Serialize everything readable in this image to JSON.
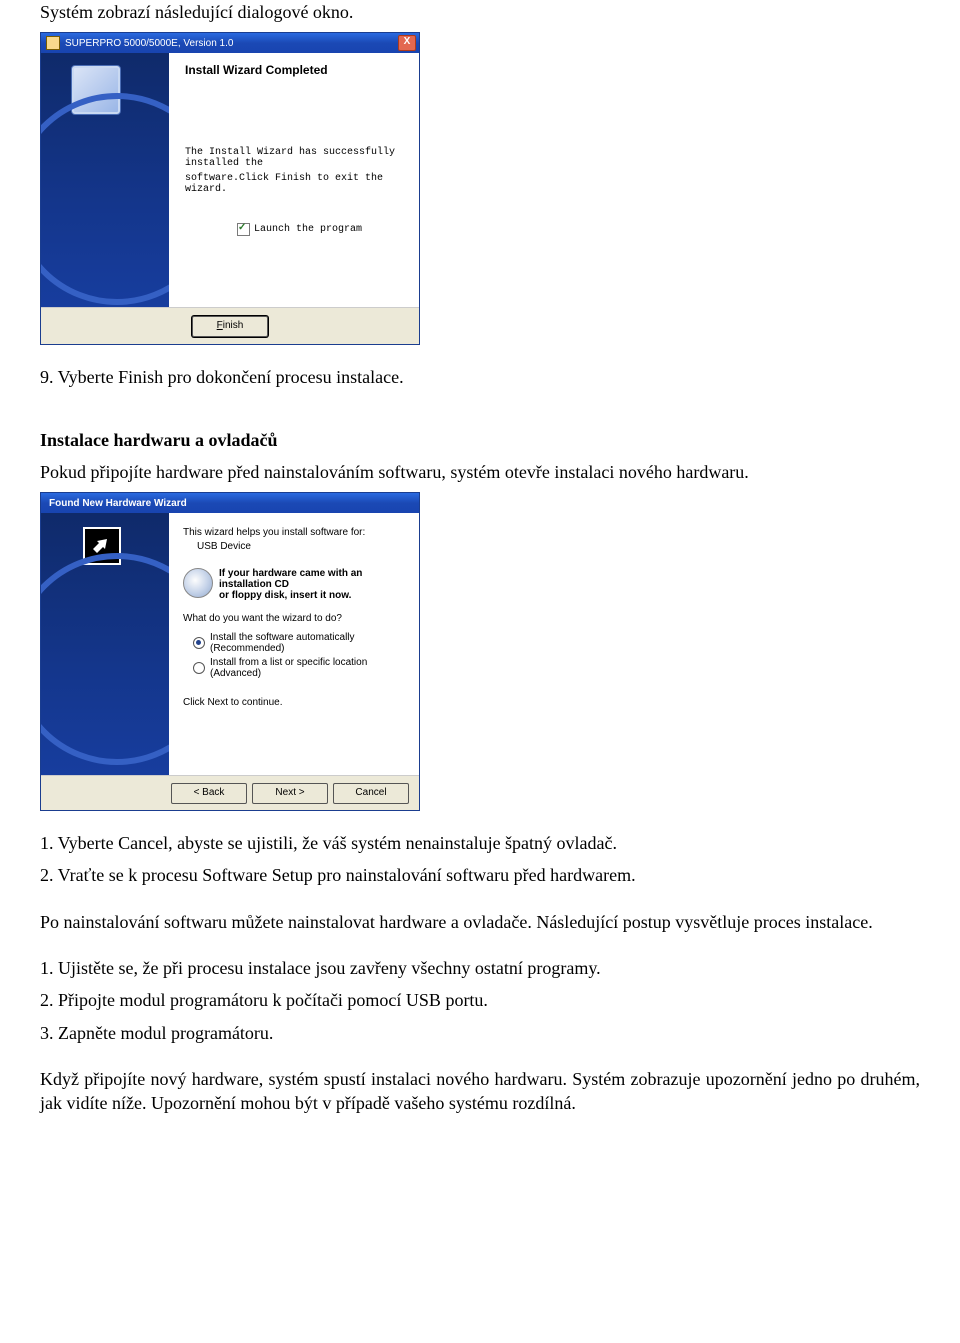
{
  "doc": {
    "intro": "Systém zobrazí následující dialogové okno.",
    "after_dlg1": "9. Vyberte Finish pro dokončení procesu instalace.",
    "section_title": "Instalace hardwaru a ovladačů",
    "section_intro": "Pokud připojíte hardware před nainstalováním softwaru, systém otevře instalaci nového hardwaru.",
    "numbered1": "1. Vyberte Cancel, abyste se ujistili, že váš systém nenainstaluje špatný ovladač.",
    "numbered2": "2. Vraťte se k procesu Software Setup pro nainstalování softwaru před hardwarem.",
    "para2": "Po nainstalování softwaru můžete nainstalovat hardware a ovladače. Následující postup vysvětluje proces instalace.",
    "num2_1": "1. Ujistěte se, že při procesu instalace jsou zavřeny všechny ostatní programy.",
    "num2_2": "2. Připojte modul programátoru k počítači pomocí USB portu.",
    "num2_3": "3. Zapněte modul programátoru.",
    "final": "Když připojíte nový hardware, systém spustí instalaci nového hardwaru. Systém zobrazuje upozornění jedno po druhém, jak vidíte níže. Upozornění mohou být v případě vašeho systému rozdílná."
  },
  "dlg1": {
    "title": "SUPERPRO 5000/5000E, Version 1.0",
    "close": "X",
    "heading": "Install Wizard Completed",
    "line1": "The Install Wizard has successfully installed  the",
    "line2": "software.Click Finish  to exit the wizard.",
    "check_label": "Launch the program",
    "finish_label": "Finish"
  },
  "dlg2": {
    "title": "Found New Hardware Wizard",
    "sub": "This wizard helps you install software for:",
    "dev": "USB Device",
    "info1": "If your hardware came with an installation CD",
    "info2": "or floppy disk, insert it now.",
    "question": "What do you want the wizard to do?",
    "opt1": "Install the software automatically (Recommended)",
    "opt2": "Install from a list or specific location (Advanced)",
    "cont": "Click Next to continue.",
    "back": "< Back",
    "next": "Next >",
    "cancel": "Cancel"
  }
}
